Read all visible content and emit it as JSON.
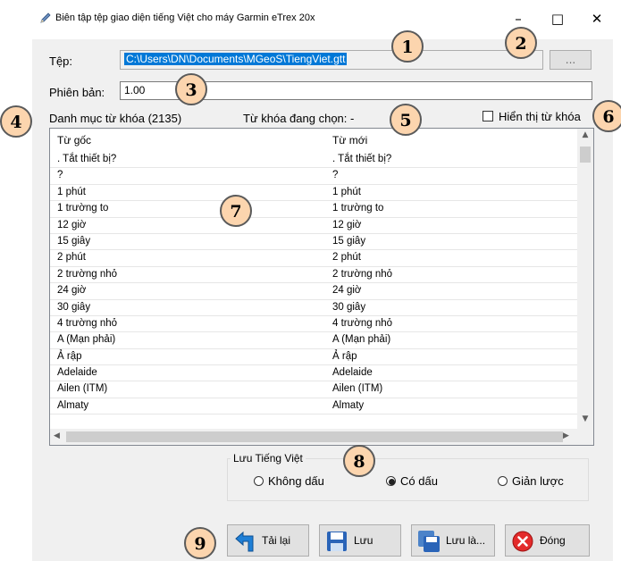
{
  "window": {
    "title": "Biên tập tệp giao diện tiếng Việt cho máy Garmin eTrex 20x",
    "min_label": "–",
    "max_label": "□",
    "close_label": "✕"
  },
  "file": {
    "label": "Tệp:",
    "path": "C:\\Users\\DN\\Documents\\MGeoS\\TiengViet.gtt",
    "browse_label": "..."
  },
  "version": {
    "label": "Phiên bản:",
    "value": "1.00"
  },
  "keywords": {
    "list_label": "Danh mục từ khóa (2135)",
    "selected_label": "Từ khóa đang chọn: -",
    "show_checkbox_label": "Hiển thị từ khóa",
    "show_checked": false
  },
  "table": {
    "col_original": "Từ gốc",
    "col_new": "Từ mới",
    "rows": [
      {
        "original": ". Tắt thiết bị?",
        "new": ". Tắt thiết bị?"
      },
      {
        "original": "?",
        "new": "?"
      },
      {
        "original": "1 phút",
        "new": "1 phút"
      },
      {
        "original": "1 trường to",
        "new": "1 trường to"
      },
      {
        "original": "12 giờ",
        "new": "12 giờ"
      },
      {
        "original": "15 giây",
        "new": "15 giây"
      },
      {
        "original": "2 phút",
        "new": "2 phút"
      },
      {
        "original": "2 trường nhỏ",
        "new": "2 trường nhỏ"
      },
      {
        "original": "24 giờ",
        "new": "24 giờ"
      },
      {
        "original": "30 giây",
        "new": "30 giây"
      },
      {
        "original": "4 trường nhỏ",
        "new": "4 trường nhỏ"
      },
      {
        "original": "A (Mạn phải)",
        "new": "A (Mạn phải)"
      },
      {
        "original": "Ả rập",
        "new": "Ả rập"
      },
      {
        "original": "Adelaide",
        "new": "Adelaide"
      },
      {
        "original": "Ailen (ITM)",
        "new": "Ailen (ITM)"
      },
      {
        "original": "Almaty",
        "new": "Almaty"
      }
    ]
  },
  "save_options": {
    "legend": "Lưu Tiếng Việt",
    "options": [
      "Không dấu",
      "Có dấu",
      "Giản lược"
    ],
    "selected": "Có dấu"
  },
  "buttons": {
    "reload": "Tải lại",
    "save": "Lưu",
    "save_as": "Lưu là...",
    "close": "Đóng"
  },
  "callouts": [
    "1",
    "2",
    "3",
    "4",
    "5",
    "6",
    "7",
    "8",
    "9"
  ],
  "icons": {
    "title": "pencil-icon",
    "reload": "back-arrow-icon",
    "save": "floppy-disk-icon",
    "save_as": "save-as-icon",
    "close": "red-x-icon"
  },
  "colors": {
    "selection": "#0078d7",
    "callout_fill": "#fcd5ae",
    "close_icon": "#e32b2b",
    "reload_icon": "#1f7fd6"
  }
}
